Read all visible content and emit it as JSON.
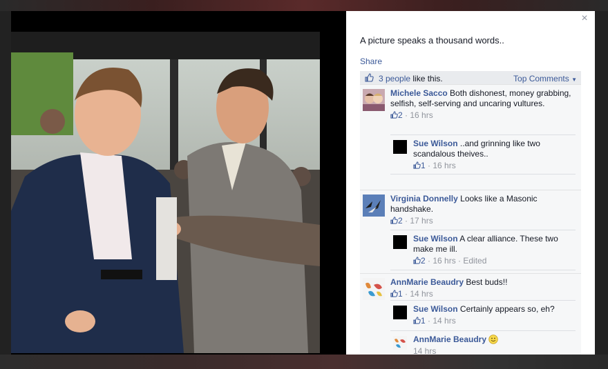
{
  "post": {
    "caption": "A picture speaks a thousand words..",
    "share_label": "Share",
    "likes_count": "3 people",
    "likes_suffix": " like this.",
    "sort_label": "Top Comments",
    "close_symbol": "×"
  },
  "comments": [
    {
      "author": "Michele Sacco",
      "text": " Both dishonest, money grabbing, selfish, self-serving and uncaring vultures.",
      "likes": "2",
      "time": " · 16 hrs",
      "replies": [
        {
          "author": "Sue Wilson",
          "text": " ..and grinning like two scandalous theives..",
          "likes": "1",
          "time": " · 16 hrs"
        }
      ]
    },
    {
      "author": "Virginia Donnelly",
      "text": " Looks like a Masonic handshake.",
      "likes": "2",
      "time": " · 17 hrs",
      "replies": [
        {
          "author": "Sue Wilson",
          "text": " A clear alliance. These two make me ill.",
          "likes": "2",
          "time": " · 16 hrs · Edited"
        }
      ]
    },
    {
      "author": "AnnMarie Beaudry",
      "text": " Best buds!!",
      "likes": "1",
      "time": " · 14 hrs",
      "replies": [
        {
          "author": "Sue Wilson",
          "text": " Certainly appears so, eh?",
          "likes": "1",
          "time": " · 14 hrs"
        },
        {
          "author": "AnnMarie Beaudry",
          "text": "",
          "likes": "",
          "time": "14 hrs"
        }
      ]
    }
  ],
  "colors": {
    "link": "#3b5998",
    "meta": "#90949c",
    "panel_bg": "#f6f7f8"
  },
  "icons": [
    "close-icon",
    "like-thumb-icon",
    "caret-down-icon",
    "smiley-icon"
  ]
}
